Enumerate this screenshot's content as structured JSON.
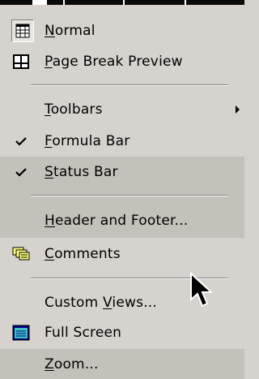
{
  "menu": {
    "items": [
      {
        "key": "normal",
        "pre": "",
        "u": "N",
        "post": "ormal",
        "icon": "normal-view-icon"
      },
      {
        "key": "page_break",
        "pre": "",
        "u": "P",
        "post": "age Break Preview",
        "icon": "page-break-preview-icon"
      },
      {
        "key": "toolbars",
        "pre": "",
        "u": "T",
        "post": "oolbars",
        "submenu": true
      },
      {
        "key": "formula_bar",
        "pre": "",
        "u": "F",
        "post": "ormula Bar",
        "checked": true
      },
      {
        "key": "status_bar",
        "pre": "",
        "u": "S",
        "post": "tatus Bar",
        "checked": true
      },
      {
        "key": "header_footer",
        "pre": "",
        "u": "H",
        "post": "eader and Footer..."
      },
      {
        "key": "comments",
        "pre": "",
        "u": "C",
        "post": "omments",
        "icon": "comments-icon"
      },
      {
        "key": "custom_views",
        "pre": "Custom ",
        "u": "V",
        "post": "iews..."
      },
      {
        "key": "full_screen",
        "pre": "Full Screen",
        "u": "",
        "post": "",
        "icon": "full-screen-icon"
      },
      {
        "key": "zoom",
        "pre": "",
        "u": "Z",
        "post": "oom..."
      }
    ]
  },
  "icons": {
    "normal": "normal-view-icon",
    "page_break": "page-break-preview-icon",
    "check": "checkmark-icon",
    "submenu": "submenu-arrow-icon",
    "comments": "comments-icon",
    "full_screen": "full-screen-icon",
    "cursor": "mouse-pointer-icon"
  },
  "colors": {
    "menu_bg": "#d6d3ce",
    "shaded_bg": "#c4c1bb"
  }
}
